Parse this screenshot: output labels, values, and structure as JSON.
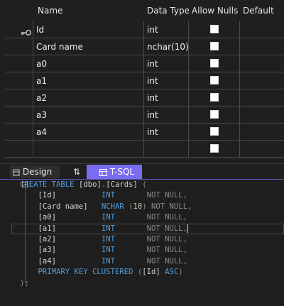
{
  "grid": {
    "headers": {
      "name": "Name",
      "data_type": "Data Type",
      "allow_nulls": "Allow Nulls",
      "default": "Default"
    },
    "rows": [
      {
        "name": "Id",
        "data_type": "int",
        "primary_key": true,
        "allow_nulls": false
      },
      {
        "name": "Card name",
        "data_type": "nchar(10)",
        "primary_key": false,
        "allow_nulls": false
      },
      {
        "name": "a0",
        "data_type": "int",
        "primary_key": false,
        "allow_nulls": false
      },
      {
        "name": "a1",
        "data_type": "int",
        "primary_key": false,
        "allow_nulls": false
      },
      {
        "name": "a2",
        "data_type": "int",
        "primary_key": false,
        "allow_nulls": false
      },
      {
        "name": "a3",
        "data_type": "int",
        "primary_key": false,
        "allow_nulls": false
      },
      {
        "name": "a4",
        "data_type": "int",
        "primary_key": false,
        "allow_nulls": false
      },
      {
        "name": "",
        "data_type": "",
        "primary_key": false,
        "allow_nulls": false
      }
    ]
  },
  "tabs": {
    "design": "Design",
    "swap": "⇅",
    "tsql": "T-SQL",
    "active": "T-SQL"
  },
  "sql": {
    "create": "CREATE",
    "table": "TABLE",
    "schema": "[dbo]",
    "table_name": "[Cards]",
    "open_paren": "(",
    "columns": [
      {
        "name": "[Id]",
        "type": "INT",
        "constraint": "NOT NULL,"
      },
      {
        "name": "[Card name]",
        "type": "NCHAR",
        "size": "10",
        "constraint": "NOT NULL,"
      },
      {
        "name": "[a0]",
        "type": "INT",
        "constraint": "NOT NULL,"
      },
      {
        "name": "[a1]",
        "type": "INT",
        "constraint": "NOT NULL,"
      },
      {
        "name": "[a2]",
        "type": "INT",
        "constraint": "NOT NULL,"
      },
      {
        "name": "[a3]",
        "type": "INT",
        "constraint": "NOT NULL,"
      },
      {
        "name": "[a4]",
        "type": "INT",
        "constraint": "NOT NULL,"
      }
    ],
    "pk": {
      "keyword": "PRIMARY KEY CLUSTERED",
      "column": "[Id]",
      "order": "ASC"
    },
    "close": ");"
  },
  "colors": {
    "keyword": "#569cd6",
    "accent": "#7a6cf0",
    "number": "#b5cea8"
  }
}
